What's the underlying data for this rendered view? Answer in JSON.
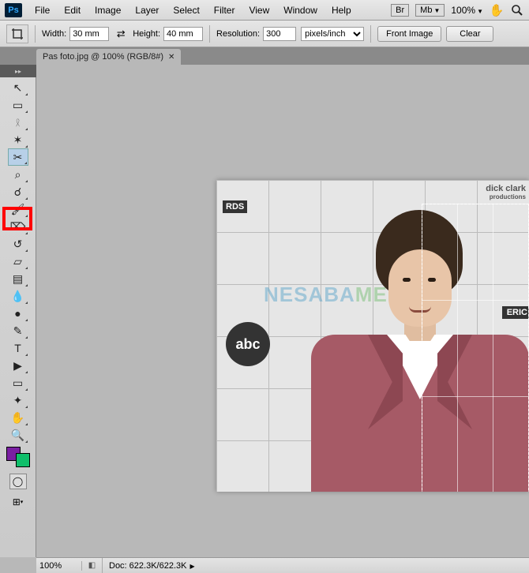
{
  "menu": {
    "items": [
      "File",
      "Edit",
      "Image",
      "Layer",
      "Select",
      "Filter",
      "View",
      "Window",
      "Help"
    ],
    "br": "Br",
    "mb": "Mb",
    "zoom": "100%"
  },
  "options": {
    "width_label": "Width:",
    "width_value": "30 mm",
    "height_label": "Height:",
    "height_value": "40 mm",
    "res_label": "Resolution:",
    "res_value": "300",
    "res_unit": "pixels/inch",
    "front_image": "Front Image",
    "clear": "Clear"
  },
  "tab": {
    "title": "Pas foto.jpg @ 100% (RGB/8#)"
  },
  "tools": [
    {
      "n": "move-tool",
      "g": "↖",
      "t": true
    },
    {
      "n": "marquee-tool",
      "g": "▭",
      "t": true
    },
    {
      "n": "lasso-tool",
      "g": "𓍲",
      "t": true
    },
    {
      "n": "quick-select-tool",
      "g": "✶",
      "t": true
    },
    {
      "n": "crop-tool",
      "g": "✂",
      "t": true,
      "sel": true
    },
    {
      "n": "eyedropper-tool",
      "g": "⌕",
      "t": true
    },
    {
      "n": "healing-brush-tool",
      "g": "☌",
      "t": true
    },
    {
      "n": "brush-tool",
      "g": "🖌",
      "t": true
    },
    {
      "n": "clone-stamp-tool",
      "g": "⌦",
      "t": true
    },
    {
      "n": "history-brush-tool",
      "g": "↺",
      "t": true
    },
    {
      "n": "eraser-tool",
      "g": "▱",
      "t": true
    },
    {
      "n": "gradient-tool",
      "g": "▤",
      "t": true
    },
    {
      "n": "blur-tool",
      "g": "💧",
      "t": true
    },
    {
      "n": "dodge-tool",
      "g": "●",
      "t": true
    },
    {
      "n": "pen-tool",
      "g": "✎",
      "t": true
    },
    {
      "n": "type-tool",
      "g": "T",
      "t": true
    },
    {
      "n": "path-select-tool",
      "g": "▶",
      "t": true
    },
    {
      "n": "shape-tool",
      "g": "▭",
      "t": true
    },
    {
      "n": "3d-tool",
      "g": "✦",
      "t": true
    },
    {
      "n": "hand-tool",
      "g": "✋",
      "t": true
    },
    {
      "n": "zoom-tool",
      "g": "🔍",
      "t": true
    }
  ],
  "colors": {
    "fg": "#7a1fa2",
    "bg": "#0fbf6a"
  },
  "canvas": {
    "watermark": "NESABAMEDIA",
    "rds": "RDS",
    "abc": "abc",
    "dick": "dick clark",
    "prod": "productions",
    "eric": "ERIC"
  },
  "status": {
    "zoom": "100%",
    "doc": "Doc: 622.3K/622.3K"
  }
}
